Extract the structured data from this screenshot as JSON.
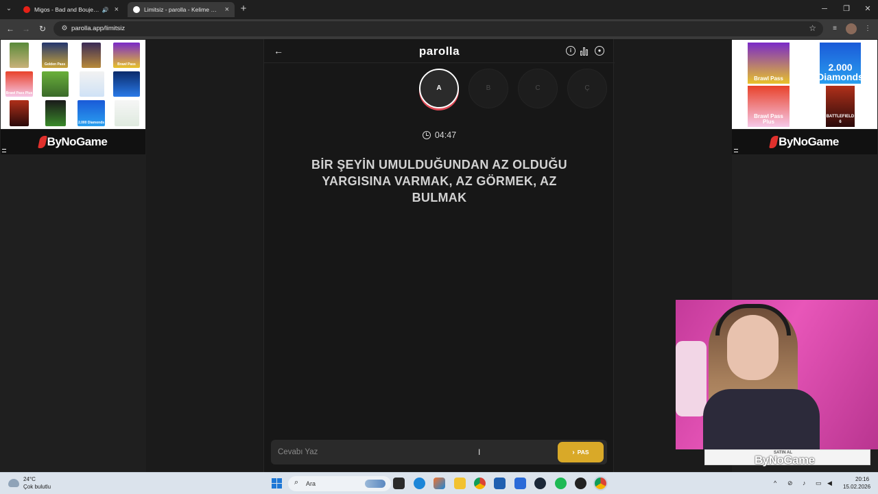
{
  "browser": {
    "tabs": [
      {
        "title": "Migos - Bad and Boujee ft Lil Uzi Vert",
        "active": false
      },
      {
        "title": "Limitsiz - parolla - Kelime oyunu",
        "active": true
      }
    ],
    "url": "parolla.app/limitsiz"
  },
  "ads": {
    "left_brand": "ByNoGame",
    "right_brand": "ByNoGame",
    "left_tiles": [
      "",
      "Golden Pass",
      "",
      "Brawl Pass",
      "Brawl Pass Plus",
      "",
      "",
      "",
      "",
      "",
      "2.000 Diamonds",
      ""
    ],
    "right_tiles": [
      "Brawl Pass",
      "2.000 Diamonds",
      "Brawl Pass Plus",
      "BATTLEFIELD 6"
    ]
  },
  "game": {
    "logo": "parolla",
    "letters": [
      "A",
      "B",
      "C",
      "Ç"
    ],
    "active_letter": "A",
    "timer": "04:47",
    "question": "BİR ŞEYİN UMULDUĞUNDAN AZ OLDUĞU YARGISINA VARMAK, AZ GÖRMEK, AZ BULMAK",
    "answer_placeholder": "Cevabı Yaz",
    "pass_label": "PAS"
  },
  "overlay": {
    "caption": "SATIN AL",
    "brand": "ByNoGame"
  },
  "taskbar": {
    "weather_temp": "24°C",
    "weather_desc": "Çok bulutlu",
    "search_label": "Ara",
    "time": "20:16",
    "date": "15.02.2026"
  },
  "colors": {
    "accent_yellow": "#d9a928",
    "active_ring_red": "#e14b57",
    "app_bg": "#171717"
  }
}
